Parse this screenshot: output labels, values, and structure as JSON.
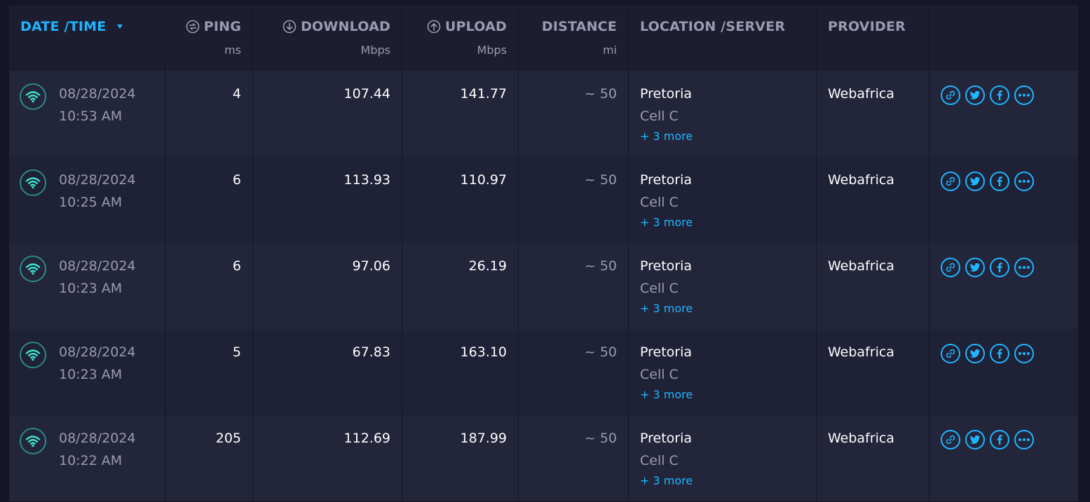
{
  "header": {
    "date": "DATE /TIME",
    "ping": "PING",
    "ping_unit": "ms",
    "download": "DOWNLOAD",
    "download_unit": "Mbps",
    "upload": "UPLOAD",
    "upload_unit": "Mbps",
    "distance": "DISTANCE",
    "distance_unit": "mi",
    "location": "LOCATION /SERVER",
    "provider": "PROVIDER"
  },
  "colors": {
    "accent": "#1fb6ff",
    "wifi": "#3ee6d0",
    "background": "#141526"
  },
  "icons": {
    "connection": "wifi-icon",
    "actions": [
      "link-icon",
      "twitter-icon",
      "facebook-icon",
      "more-icon"
    ]
  },
  "rows": [
    {
      "date": "08/28/2024",
      "time": "10:53 AM",
      "ping": "4",
      "download": "107.44",
      "upload": "141.77",
      "distance": "~ 50",
      "city": "Pretoria",
      "sponsor": "Cell C",
      "more": "+ 3 more",
      "provider": "Webafrica"
    },
    {
      "date": "08/28/2024",
      "time": "10:25 AM",
      "ping": "6",
      "download": "113.93",
      "upload": "110.97",
      "distance": "~ 50",
      "city": "Pretoria",
      "sponsor": "Cell C",
      "more": "+ 3 more",
      "provider": "Webafrica"
    },
    {
      "date": "08/28/2024",
      "time": "10:23 AM",
      "ping": "6",
      "download": "97.06",
      "upload": "26.19",
      "distance": "~ 50",
      "city": "Pretoria",
      "sponsor": "Cell C",
      "more": "+ 3 more",
      "provider": "Webafrica"
    },
    {
      "date": "08/28/2024",
      "time": "10:23 AM",
      "ping": "5",
      "download": "67.83",
      "upload": "163.10",
      "distance": "~ 50",
      "city": "Pretoria",
      "sponsor": "Cell C",
      "more": "+ 3 more",
      "provider": "Webafrica"
    },
    {
      "date": "08/28/2024",
      "time": "10:22 AM",
      "ping": "205",
      "download": "112.69",
      "upload": "187.99",
      "distance": "~ 50",
      "city": "Pretoria",
      "sponsor": "Cell C",
      "more": "+ 3 more",
      "provider": "Webafrica"
    }
  ]
}
